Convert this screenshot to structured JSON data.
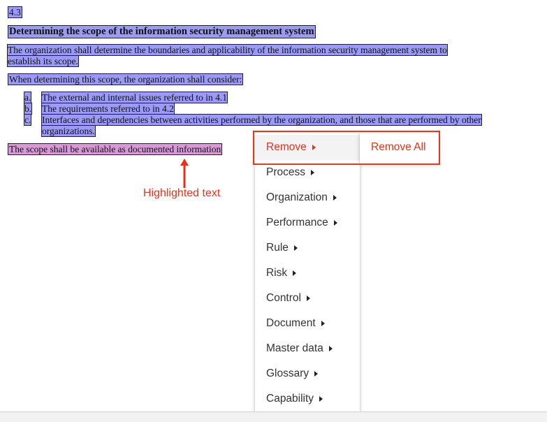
{
  "document": {
    "section_number": "4.3",
    "section_title": "Determining the scope of the information security management system",
    "paragraph1_line1": "The organization shall determine the boundaries and applicability of the information security management system to",
    "paragraph1_line2": "establish its scope.",
    "paragraph2": "When determining this scope, the organization shall consider:",
    "list": [
      {
        "marker": "a.",
        "text": "The external and internal issues referred to in 4.1"
      },
      {
        "marker": "b.",
        "text": "The requirements referred to in 4.2"
      },
      {
        "marker": "c.",
        "text_line1": "Interfaces and dependencies between activities performed by the organization, and those that are performed by other",
        "text_line2": "organizations."
      }
    ],
    "scope_statement": "The scope shall be available as documented information"
  },
  "annotation": {
    "label": "Highlighted text",
    "color": "#e8311a"
  },
  "context_menu": {
    "items": [
      {
        "label": "Remove",
        "active": true
      },
      {
        "label": "Process"
      },
      {
        "label": "Organization"
      },
      {
        "label": "Performance"
      },
      {
        "label": "Rule"
      },
      {
        "label": "Risk"
      },
      {
        "label": "Control"
      },
      {
        "label": "Document"
      },
      {
        "label": "Master data"
      },
      {
        "label": "Glossary"
      },
      {
        "label": "Capability"
      }
    ],
    "submenu": {
      "label": "Remove All"
    }
  },
  "colors": {
    "highlight_blue": "#9b9bf7",
    "highlight_pink": "#d69ad6",
    "accent_red": "#e8311a"
  }
}
